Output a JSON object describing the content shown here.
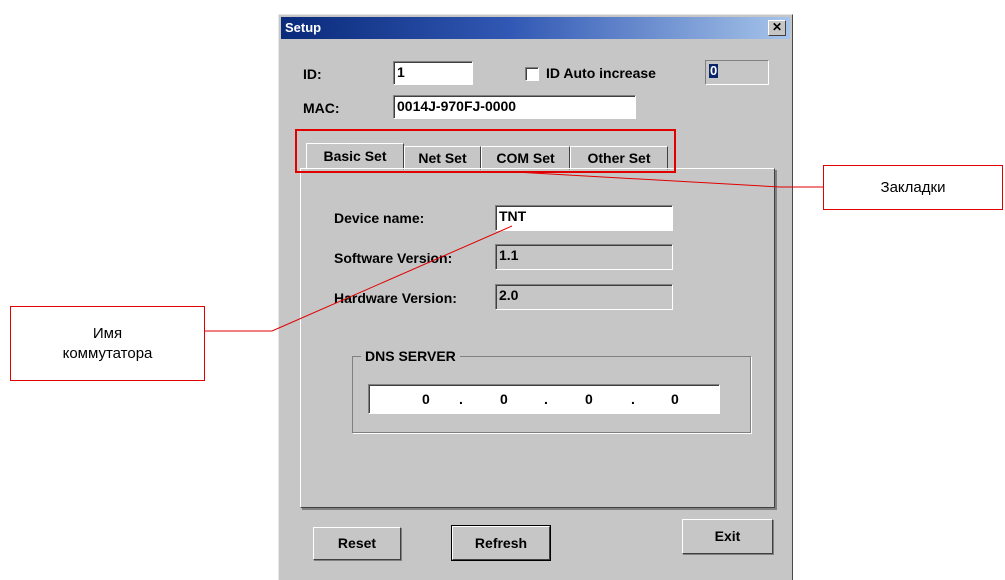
{
  "window": {
    "title": "Setup",
    "close_glyph": "✕"
  },
  "header": {
    "id_label": "ID:",
    "id_value": "1",
    "auto_increase_label": "ID Auto increase",
    "auto_increase_checked": false,
    "auto_increase_counter": "0",
    "mac_label": "MAC:",
    "mac_value": "0014J-970FJ-0000"
  },
  "tabs": [
    {
      "label": "Basic Set",
      "active": true
    },
    {
      "label": "Net Set",
      "active": false
    },
    {
      "label": "COM Set",
      "active": false
    },
    {
      "label": "Other Set",
      "active": false
    }
  ],
  "basic_set": {
    "device_name_label": "Device name:",
    "device_name_value": "TNT",
    "software_version_label": "Software Version:",
    "software_version_value": "1.1",
    "hardware_version_label": "Hardware Version:",
    "hardware_version_value": "2.0",
    "dns_group_title": "DNS SERVER",
    "dns_octets": [
      "0",
      "0",
      "0",
      "0"
    ],
    "dns_separator": "."
  },
  "buttons": {
    "reset": "Reset",
    "refresh": "Refresh",
    "exit": "Exit"
  },
  "annotations": {
    "tabs_callout": "Закладки",
    "device_name_callout": "Имя коммутатора",
    "highlight_color": "#e00000"
  }
}
